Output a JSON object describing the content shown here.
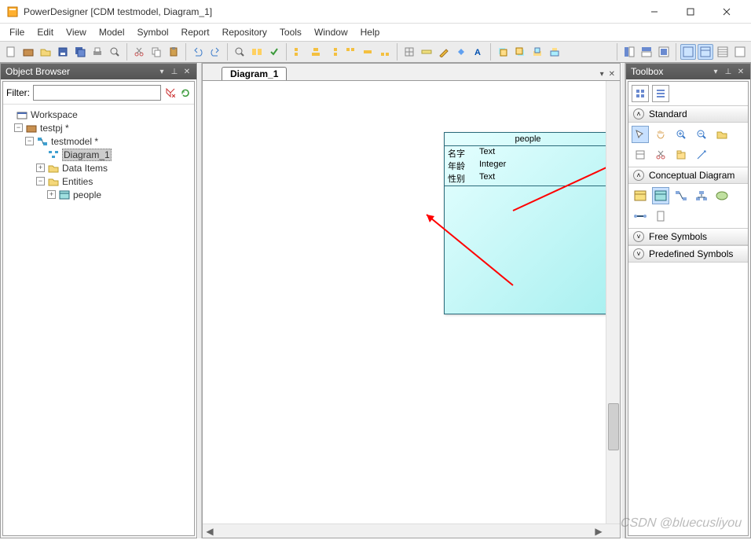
{
  "titlebar": {
    "app": "PowerDesigner",
    "doc": "[CDM testmodel, Diagram_1]"
  },
  "menu": [
    "File",
    "Edit",
    "View",
    "Model",
    "Symbol",
    "Report",
    "Repository",
    "Tools",
    "Window",
    "Help"
  ],
  "browser": {
    "title": "Object Browser",
    "filter_label": "Filter:",
    "tree": {
      "workspace": "Workspace",
      "project": "testpj *",
      "model": "testmodel *",
      "diagram": "Diagram_1",
      "dataitems": "Data Items",
      "entities": "Entities",
      "entity_people": "people"
    }
  },
  "center": {
    "tab": "Diagram_1"
  },
  "entity": {
    "name": "people",
    "attrs": [
      {
        "name": "名字",
        "type": "Text"
      },
      {
        "name": "年龄",
        "type": "Integer"
      },
      {
        "name": "性别",
        "type": "Text"
      }
    ]
  },
  "toolbox": {
    "title": "Toolbox",
    "sections": {
      "standard": "Standard",
      "conceptual": "Conceptual Diagram",
      "free": "Free Symbols",
      "predef": "Predefined Symbols"
    }
  },
  "watermark": "CSDN @bluecusliyou"
}
